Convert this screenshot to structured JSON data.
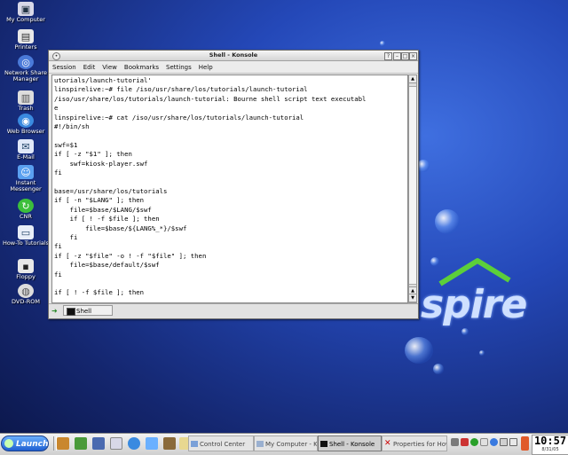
{
  "desktop": {
    "icons": [
      {
        "label": "My Computer",
        "icon": "computer-icon"
      },
      {
        "label": "Printers",
        "icon": "printer-icon"
      },
      {
        "label": "Network Share Manager",
        "icon": "network-icon"
      },
      {
        "label": "Trash",
        "icon": "trash-icon"
      },
      {
        "label": "Web Browser",
        "icon": "globe-icon"
      },
      {
        "label": "E-Mail",
        "icon": "mail-icon"
      },
      {
        "label": "Instant Messenger",
        "icon": "chat-icon"
      },
      {
        "label": "CNR",
        "icon": "cnr-icon"
      },
      {
        "label": "How-To Tutorials",
        "icon": "tutorial-icon"
      },
      {
        "label": "Floppy",
        "icon": "floppy-icon"
      },
      {
        "label": "DVD-ROM",
        "icon": "dvd-icon"
      }
    ],
    "logo_text": "spire"
  },
  "window": {
    "title": "Shell - Konsole",
    "menu": [
      "Session",
      "Edit",
      "View",
      "Bookmarks",
      "Settings",
      "Help"
    ],
    "terminal_lines": [
      "utorials/launch-tutorial'",
      "linspirelive:~# file /iso/usr/share/los/tutorials/launch-tutorial",
      "/iso/usr/share/los/tutorials/launch-tutorial: Bourne shell script text executabl",
      "e",
      "linspirelive:~# cat /iso/usr/share/los/tutorials/launch-tutorial",
      "#!/bin/sh",
      "",
      "swf=$1",
      "if [ -z \"$1\" ]; then",
      "    swf=kiosk-player.swf",
      "fi",
      "",
      "base=/usr/share/los/tutorials",
      "if [ -n \"$LANG\" ]; then",
      "    file=$base/$LANG/$swf",
      "    if [ ! -f $file ]; then",
      "        file=$base/${LANG%_*}/$swf",
      "    fi",
      "fi",
      "if [ -z \"$file\" -o ! -f \"$file\" ]; then",
      "    file=$base/default/$swf",
      "fi",
      "",
      "if [ ! -f $file ]; then"
    ],
    "tab_label": "Shell"
  },
  "taskbar": {
    "launch_label": "Launch",
    "tasks": [
      {
        "label": "Control Center",
        "active": false
      },
      {
        "label": "My Computer - Ko",
        "active": false
      },
      {
        "label": "Shell - Konsole",
        "active": true
      },
      {
        "label": "Properties for How",
        "active": false
      }
    ],
    "clock_time": "10:57",
    "clock_date": "8/31/05"
  },
  "colors": {
    "desktop_bg": "#2448b8",
    "launch_button": "#1f5fd0"
  }
}
